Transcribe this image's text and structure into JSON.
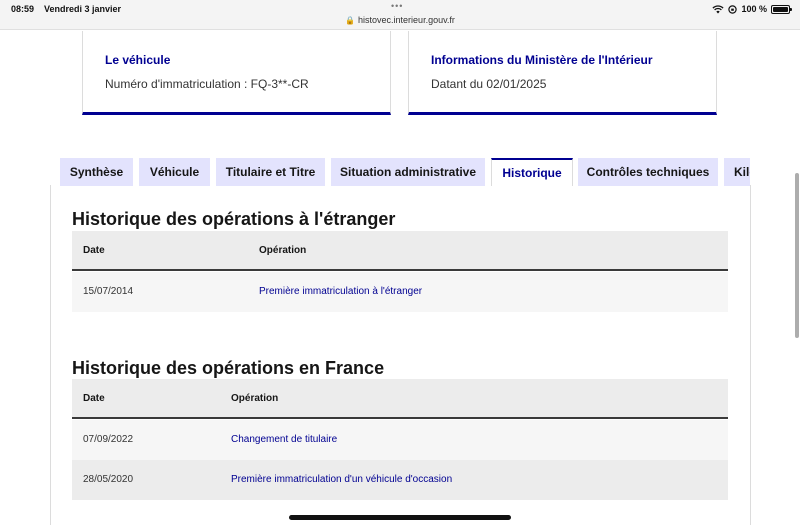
{
  "status_bar": {
    "time": "08:59",
    "date": "Vendredi 3 janvier",
    "dots": "•••",
    "url": "histovec.interieur.gouv.fr",
    "battery": "100 %"
  },
  "cards": [
    {
      "title": "Le véhicule",
      "text": "Numéro d'immatriculation : FQ-3**-CR"
    },
    {
      "title": "Informations du Ministère de l'Intérieur",
      "text": "Datant du 02/01/2025"
    }
  ],
  "tabs": [
    {
      "label": "Synthèse",
      "active": false
    },
    {
      "label": "Véhicule",
      "active": false
    },
    {
      "label": "Titulaire et Titre",
      "active": false
    },
    {
      "label": "Situation administrative",
      "active": false
    },
    {
      "label": "Historique",
      "active": true
    },
    {
      "label": "Contrôles techniques",
      "active": false
    },
    {
      "label": "Kilo",
      "active": false
    }
  ],
  "sections": [
    {
      "title": "Historique des opérations à l'étranger",
      "columns": [
        "Date",
        "Opération"
      ],
      "rows": [
        {
          "date": "15/07/2014",
          "operation": "Première immatriculation à l'étranger"
        }
      ]
    },
    {
      "title": "Historique des opérations en France",
      "columns": [
        "Date",
        "Opération"
      ],
      "rows": [
        {
          "date": "07/09/2022",
          "operation": "Changement de titulaire"
        },
        {
          "date": "28/05/2020",
          "operation": "Première immatriculation d'un véhicule d'occasion"
        }
      ]
    }
  ],
  "colors": {
    "accent": "#000091",
    "tab_bg": "#e3e3fd",
    "table_header_bg": "#ececec"
  }
}
